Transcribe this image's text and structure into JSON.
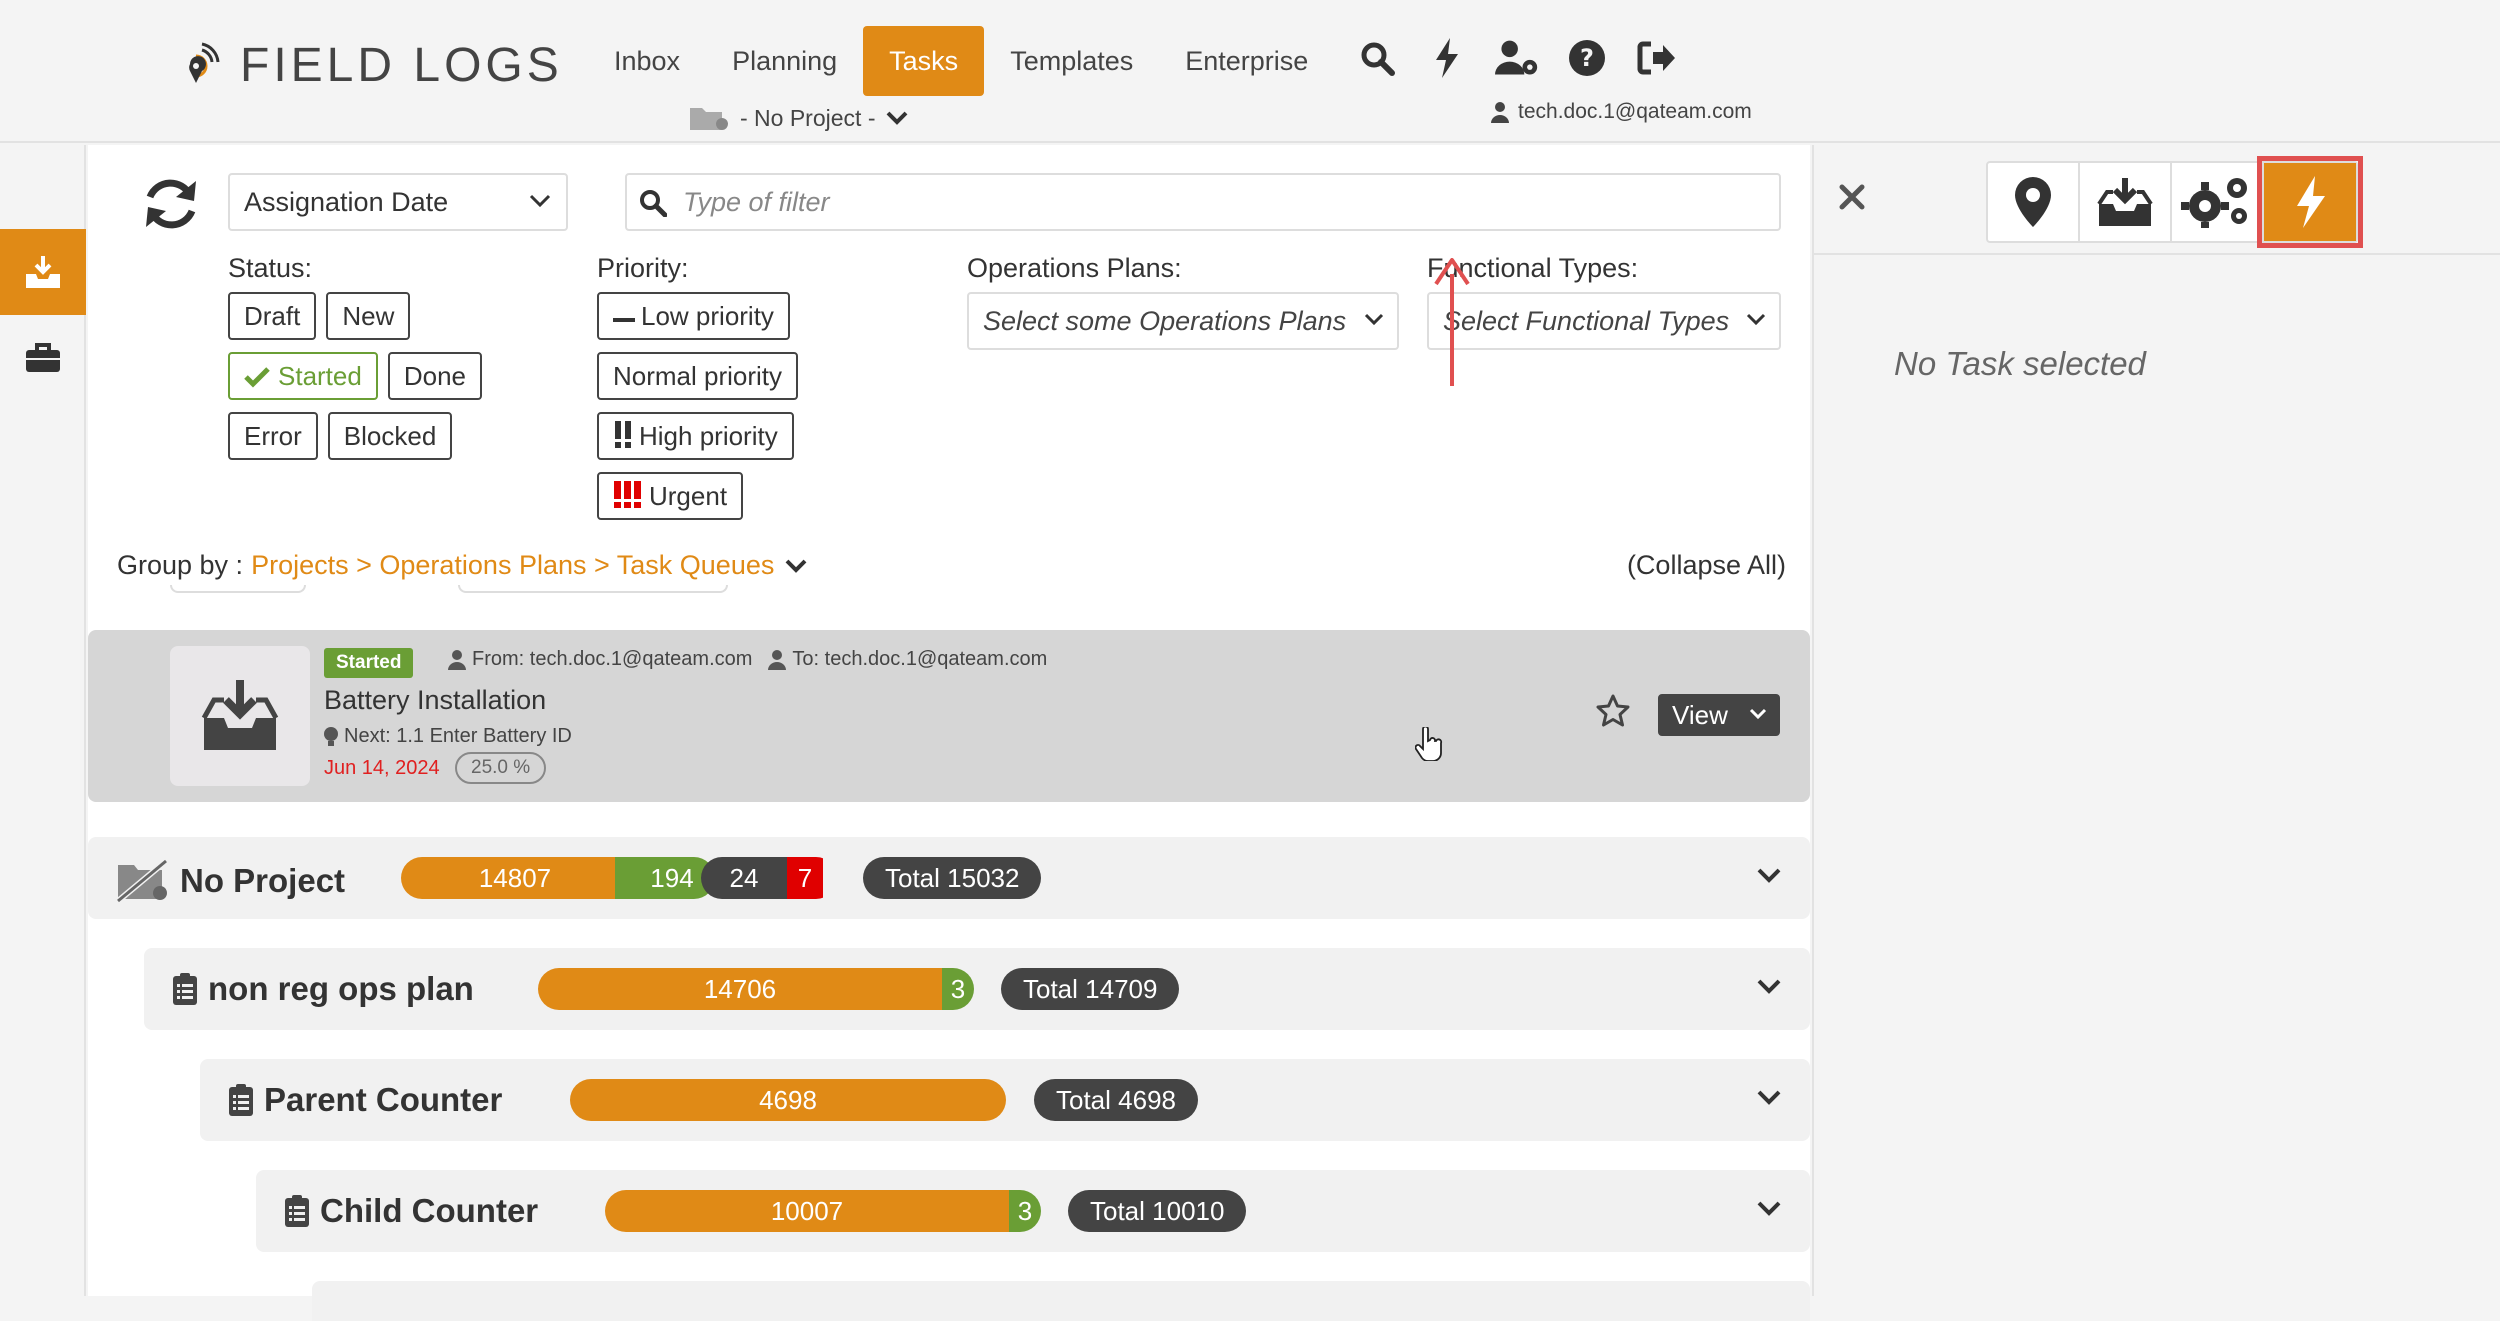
{
  "app": {
    "brand": "FIELD LOGS"
  },
  "nav": {
    "items": [
      "Inbox",
      "Planning",
      "Tasks",
      "Templates",
      "Enterprise"
    ],
    "active": "Tasks",
    "icons": [
      "search-icon",
      "bolt-icon",
      "user-settings-icon",
      "help-icon",
      "logout-icon"
    ],
    "project": "- No Project -",
    "user": "tech.doc.1@qateam.com"
  },
  "rail": {
    "items": [
      "inbox-tray-icon",
      "briefcase-icon"
    ],
    "active": "inbox-tray-icon"
  },
  "toolbar": {
    "sort_value": "Assignation Date",
    "filter_placeholder": "Type of filter"
  },
  "filters": {
    "status": {
      "label": "Status:",
      "chips": [
        "Draft",
        "New",
        "Started",
        "Done",
        "Error",
        "Blocked"
      ],
      "selected": "Started"
    },
    "priority": {
      "label": "Priority:",
      "chips": [
        "Low priority",
        "Normal priority",
        "High priority",
        "Urgent"
      ]
    },
    "ops_plans": {
      "label": "Operations Plans:",
      "placeholder": "Select some Operations Plans"
    },
    "functional_types": {
      "label": "Functional Types:",
      "placeholder": "Select Functional Types"
    }
  },
  "groupby": {
    "label": "Group by :",
    "path": "Projects > Operations Plans > Task Queues",
    "collapse": "(Collapse All)"
  },
  "task": {
    "status": "Started",
    "from": "From: tech.doc.1@qateam.com",
    "to": "To: tech.doc.1@qateam.com",
    "title": "Battery Installation",
    "next": "Next: 1.1 Enter Battery ID",
    "date": "Jun 14, 2024",
    "progress": "25.0 %",
    "view_label": "View"
  },
  "groups": [
    {
      "name": "No Project",
      "segments": [
        "14807",
        "194",
        "24",
        "7"
      ],
      "total": "Total 15032"
    },
    {
      "name": "non reg ops plan",
      "segments": [
        "14706",
        "3"
      ],
      "total": "Total 14709"
    },
    {
      "name": "Parent Counter",
      "segments": [
        "4698"
      ],
      "total": "Total 4698"
    },
    {
      "name": "Child Counter",
      "segments": [
        "10007",
        "3"
      ],
      "total": "Total 10010"
    }
  ],
  "panel": {
    "tools": [
      "map-pin-icon",
      "inbox-tray-icon",
      "gears-icon",
      "bolt-icon"
    ],
    "active_tool": "bolt-icon",
    "empty_text": "No Task selected"
  },
  "colors": {
    "accent": "#e08a16",
    "started": "#6a9e35",
    "dark": "#444444",
    "urgent": "#e00000",
    "highlight": "#e05050"
  }
}
